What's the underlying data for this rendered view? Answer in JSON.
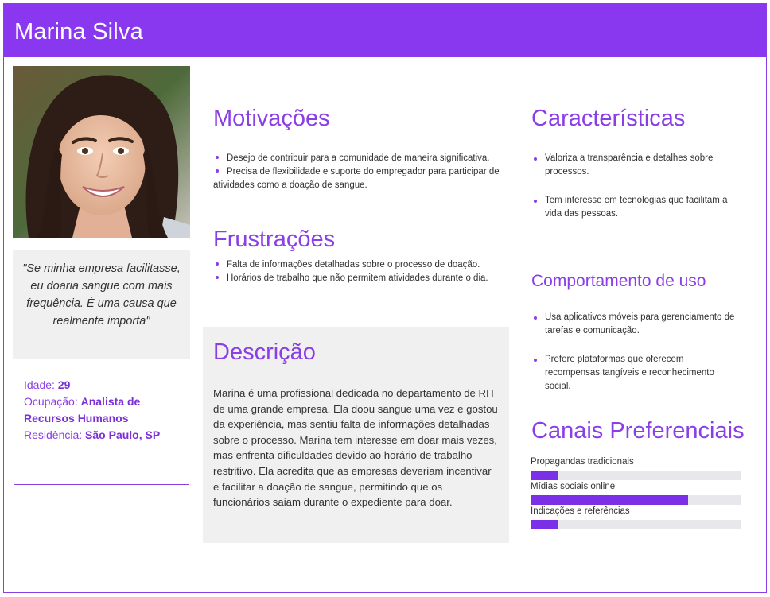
{
  "header": {
    "title": "Marina Silva"
  },
  "photo": {
    "alt": "Foto de Marina Silva"
  },
  "quote": "\"Se minha empresa facilitasse, eu doaria sangue com mais frequência. É uma causa que realmente importa\"",
  "info": {
    "age_label": "Idade:",
    "age": "29",
    "occupation_label": "Ocupação:",
    "occupation": "Analista de Recursos Humanos",
    "residence_label": "Residência:",
    "residence": "São Paulo, SP"
  },
  "motivations": {
    "title": "Motivações",
    "items": [
      "Desejo de contribuir para a comunidade de maneira significativa.",
      "Precisa de flexibilidade e suporte do empregador para participar de atividades como a doação de sangue."
    ]
  },
  "frustrations": {
    "title": "Frustrações",
    "items": [
      "Falta de informações detalhadas sobre o processo de doação.",
      "Horários de trabalho que não permitem atividades durante o dia."
    ]
  },
  "description": {
    "title": "Descrição",
    "text": "Marina é uma profissional dedicada no departamento de RH de uma grande empresa. Ela doou sangue uma vez e gostou da experiência, mas sentiu falta de informações detalhadas sobre o processo. Marina tem interesse em doar mais vezes, mas enfrenta dificuldades devido ao horário de trabalho restritivo. Ela acredita que as empresas deveriam incentivar e facilitar a doação de sangue, permitindo que os funcionários saiam durante o expediente para doar."
  },
  "characteristics": {
    "title": "Características",
    "items": [
      "Valoriza a transparência e detalhes sobre processos.",
      "Tem interesse em tecnologias que facilitam a vida das pessoas."
    ]
  },
  "usage": {
    "title": "Comportamento de uso",
    "items": [
      "Usa aplicativos móveis para gerenciamento de tarefas e comunicação.",
      "Prefere plataformas que oferecem recompensas tangíveis e reconhecimento social."
    ]
  },
  "channels": {
    "title": "Canais Preferenciais",
    "items": [
      {
        "label": "Propagandas tradicionais",
        "level": 0.13
      },
      {
        "label": "Mídias sociais online",
        "level": 0.75
      },
      {
        "label": "Indicações e referências",
        "level": 0.13
      }
    ]
  },
  "colors": {
    "accent": "#8a38f0",
    "bar_fill": "#7b2fe6",
    "bar_track": "#e8e8ec",
    "panel": "#f0f0f0"
  }
}
